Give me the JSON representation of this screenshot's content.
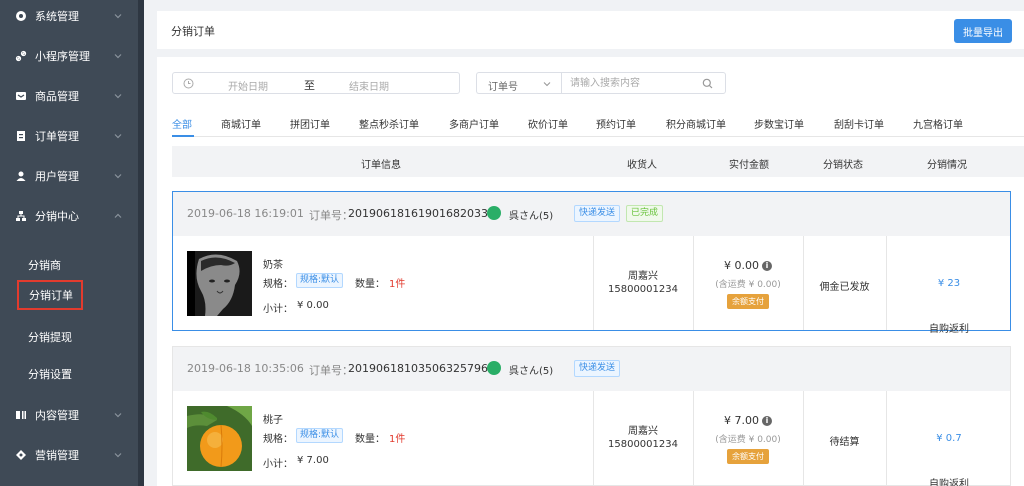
{
  "sidebar": {
    "items": [
      {
        "label": "系统管理",
        "icon": "gear-icon"
      },
      {
        "label": "小程序管理",
        "icon": "link-icon"
      },
      {
        "label": "商品管理",
        "icon": "inbox-icon"
      },
      {
        "label": "订单管理",
        "icon": "order-icon"
      },
      {
        "label": "用户管理",
        "icon": "user-icon"
      },
      {
        "label": "分销中心",
        "icon": "hierarchy-icon"
      },
      {
        "label": "内容管理",
        "icon": "content-icon"
      },
      {
        "label": "营销管理",
        "icon": "marketing-icon"
      }
    ],
    "subitems": [
      "分销商",
      "分销订单",
      "分销提现",
      "分销设置"
    ]
  },
  "header": {
    "title": "分销订单",
    "export_label": "批量导出"
  },
  "filters": {
    "date_start_placeholder": "开始日期",
    "date_separator": "至",
    "date_end_placeholder": "结束日期",
    "select_value": "订单号",
    "search_placeholder": "请输入搜索内容"
  },
  "tabs": [
    "全部",
    "商城订单",
    "拼团订单",
    "整点秒杀订单",
    "多商户订单",
    "砍价订单",
    "预约订单",
    "积分商城订单",
    "步数宝订单",
    "刮刮卡订单",
    "九宫格订单"
  ],
  "table_headers": [
    "订单信息",
    "收货人",
    "实付金额",
    "分销状态",
    "分销情况"
  ],
  "labels": {
    "order_no": "订单号：",
    "spec": "规格：",
    "qty": "数量：",
    "subtotal": "小计："
  },
  "orders": [
    {
      "date": "2019-06-18 16:19:01",
      "order_no": "20190618161901682033",
      "user": "呉さん(5)",
      "tags": [
        "快递发送",
        "已完成"
      ],
      "product_name": "奶茶",
      "spec": "规格:默认",
      "qty": "1件",
      "subtotal": "¥ 0.00",
      "receiver_name": "周嘉兴",
      "receiver_phone": "15800001234",
      "amount": "¥ 0.00",
      "shipping": "(含运费 ¥ 0.00)",
      "pay_method": "余额支付",
      "status": "佣金已发放",
      "rebate_label": "自购返利",
      "rebate_amount": "¥ 23"
    },
    {
      "date": "2019-06-18 10:35:06",
      "order_no": "20190618103506325796",
      "user": "呉さん(5)",
      "tags": [
        "快递发送"
      ],
      "product_name": "桃子",
      "spec": "规格:默认",
      "qty": "1件",
      "subtotal": "¥ 7.00",
      "receiver_name": "周嘉兴",
      "receiver_phone": "15800001234",
      "amount": "¥ 7.00",
      "shipping": "(含运费 ¥ 0.00)",
      "pay_method": "余额支付",
      "status": "待结算",
      "rebate_label": "自购返利",
      "rebate_amount": "¥ 0.7"
    }
  ],
  "colors": {
    "accent": "#3a8ee6",
    "sidebar": "#3f4a56",
    "highlight": "#e23b2e",
    "pay_tag": "#e6a23c"
  }
}
